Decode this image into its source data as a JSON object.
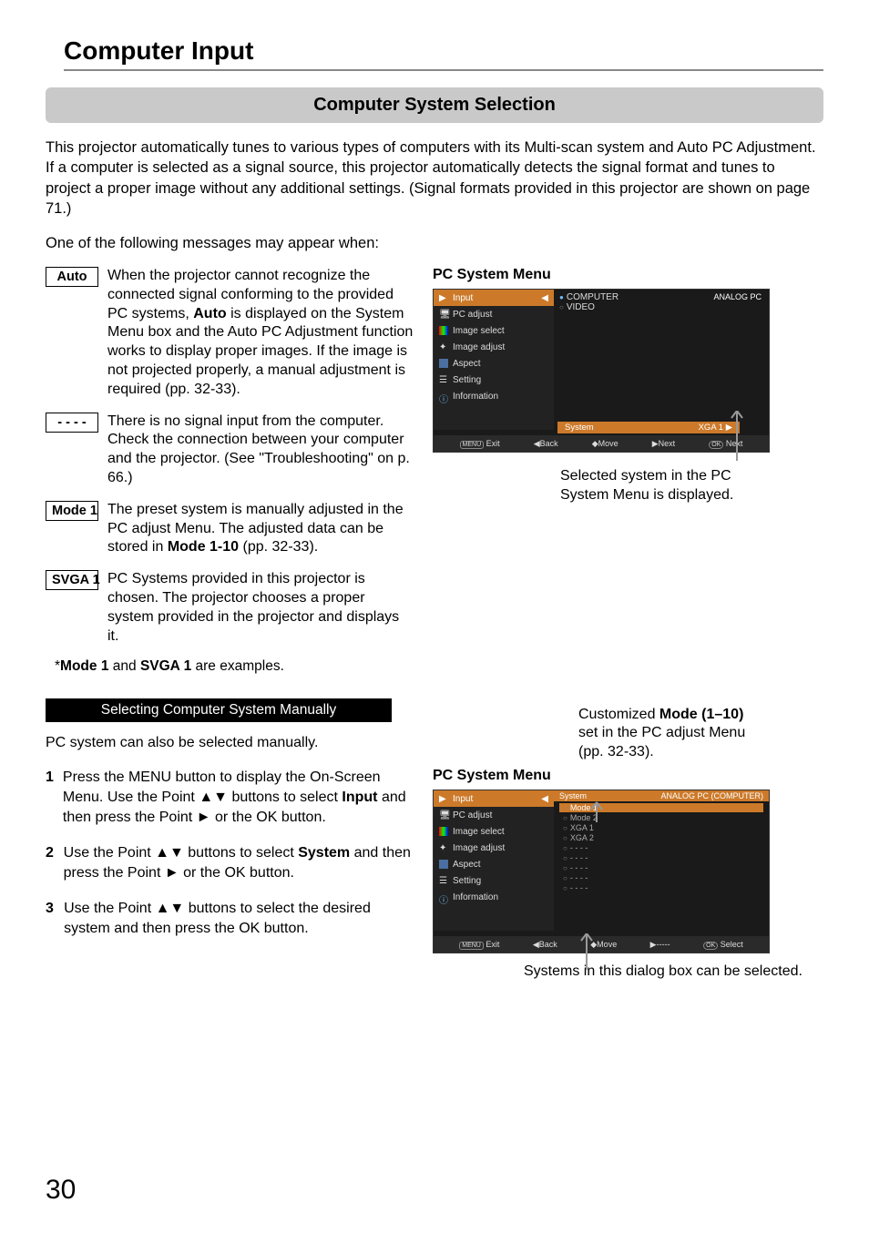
{
  "page": {
    "number": "30",
    "title": "Computer Input",
    "section_title": "Computer System Selection",
    "intro": "This projector automatically tunes to various types of computers with its Multi-scan system and Auto PC Adjustment. If a computer is selected as a signal source, this projector automatically detects the signal format and tunes to project a proper image without any additional settings. (Signal formats provided in this projector are shown on page 71.)",
    "subintro": "One of the following messages may appear when:"
  },
  "messages": [
    {
      "label": "Auto",
      "text_a": "When the projector cannot recognize the connected signal conforming to the provided PC systems, ",
      "bold": "Auto",
      "text_b": " is displayed on the System Menu box and the Auto PC Adjustment function works to display proper images. If the image is not projected properly, a manual adjustment is required (pp. 32-33)."
    },
    {
      "label": "- - - -",
      "text_a": "There is no signal input from the computer. Check the connection between your computer and the projector. (See \"Troubleshooting\" on p. 66.)",
      "bold": "",
      "text_b": ""
    },
    {
      "label": "Mode 1",
      "text_a": "The preset system is manually adjusted in the PC adjust Menu. The adjusted data can be stored in ",
      "bold": "Mode 1-10",
      "text_b": " (pp. 32-33)."
    },
    {
      "label": "SVGA 1",
      "text_a": "PC Systems provided in this projector is chosen.  The projector chooses a proper system provided in the projector and displays it.",
      "bold": "",
      "text_b": ""
    }
  ],
  "footnote_a": "*",
  "footnote_b": "Mode 1",
  "footnote_c": " and ",
  "footnote_d": "SVGA 1",
  "footnote_e": " are examples.",
  "manual": {
    "bar": "Selecting Computer System Manually",
    "intro": "PC system can also be selected manually.",
    "steps": [
      {
        "n": "1",
        "a": "Press the MENU button to display the On-Screen Menu. Use the Point ▲▼ buttons to select ",
        "b": "Input",
        "c": " and then press the Point ► or the OK button."
      },
      {
        "n": "2",
        "a": "Use the Point ▲▼ buttons to select ",
        "b": "System",
        "c": " and then press the Point ► or the OK button."
      },
      {
        "n": "3",
        "a": "Use the Point ▲▼ buttons to select the desired system and then press the OK button.",
        "b": "",
        "c": ""
      }
    ]
  },
  "figures": {
    "menu1_title": "PC System Menu",
    "menu1_caption": "Selected system in the PC System Menu is displayed.",
    "menu2_cap_a": "Customized ",
    "menu2_cap_b": "Mode (1–10)",
    "menu2_cap_c": " set in the PC adjust Menu (pp. 32-33).",
    "menu2_title": "PC System Menu",
    "menu2_caption2": "Systems in this dialog box can be selected."
  },
  "osd": {
    "sidebar": [
      "Input",
      "PC adjust",
      "Image select",
      "Image adjust",
      "Aspect",
      "Setting",
      "Information"
    ],
    "right1_opts": [
      "COMPUTER",
      "VIDEO"
    ],
    "right1_header": "ANALOG PC",
    "right1_syslabel": "System",
    "right1_sysval": "XGA 1 ▶",
    "bottom1": [
      "Exit",
      "◀Back",
      "◆Move",
      "▶Next",
      "Next"
    ],
    "right2_head_a": "System",
    "right2_head_b": "ANALOG PC (COMPUTER)",
    "right2_opts": [
      "Mode 1",
      "Mode 2",
      "XGA 1",
      "XGA 2",
      "- - - -",
      "- - - -",
      "- - - -",
      "- - - -",
      "- - - -"
    ],
    "bottom2": [
      "Exit",
      "◀Back",
      "◆Move",
      "▶-----",
      "Select"
    ]
  }
}
